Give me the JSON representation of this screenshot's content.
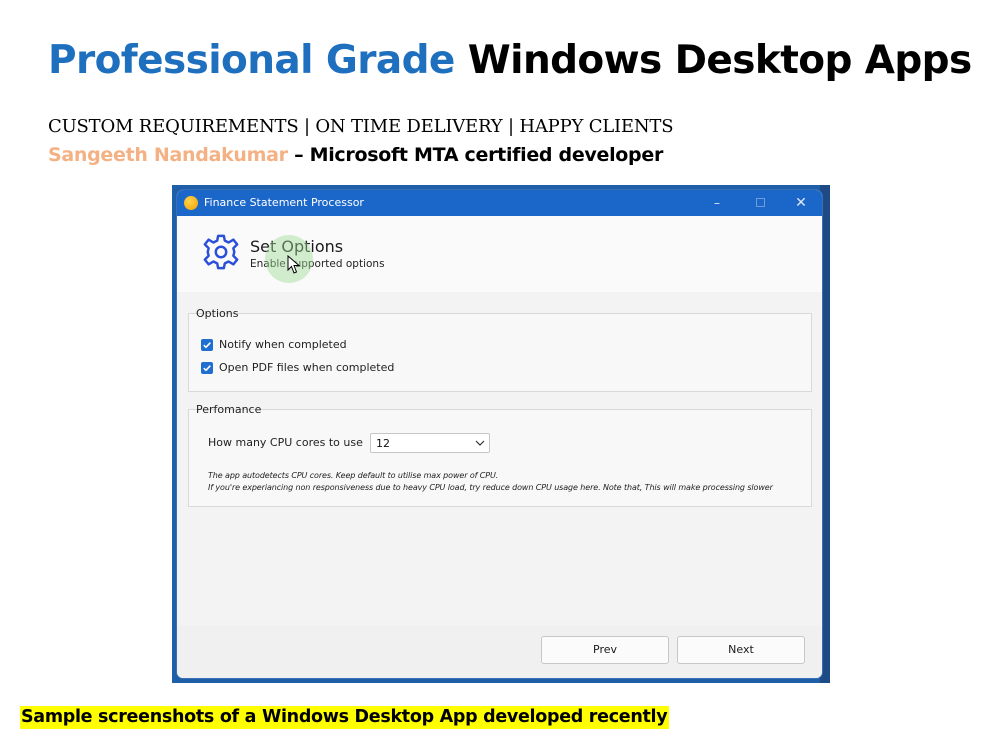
{
  "slide": {
    "title_accent": "Professional Grade",
    "title_rest": "Windows Desktop Apps",
    "subtitle": "CUSTOM REQUIREMENTS | ON TIME DELIVERY | HAPPY CLIENTS",
    "author_name": "Sangeeth Nandakumar",
    "author_desc": " – Microsoft MTA certified developer",
    "caption": "Sample screenshots of a Windows Desktop App developed recently",
    "colors": {
      "title_accent": "#1f6fbf",
      "author_name": "#f4b183",
      "caption_highlight": "#ffff00"
    }
  },
  "window": {
    "title": "Finance Statement Processor",
    "app_icon": "app-orb-icon",
    "controls": {
      "minimize": "–",
      "close": "✕"
    },
    "colors": {
      "titlebar": "#1b66c9",
      "accent": "#1f6fd0"
    }
  },
  "header": {
    "icon": "gear-icon",
    "title": "Set Options",
    "subtitle": "Enable supported options"
  },
  "options": {
    "label": "Options",
    "items": [
      {
        "label": "Notify when completed",
        "checked": true
      },
      {
        "label": "Open PDF files when completed",
        "checked": true
      }
    ]
  },
  "performance": {
    "label": "Perfomance",
    "cpu_label": "How many CPU cores to use",
    "cpu_value": "12",
    "note_line1": "The app autodetects CPU cores. Keep default to utilise max power of CPU.",
    "note_line2": "If you're experiancing non responsiveness due to heavy CPU load, try reduce down CPU usage here. Note that, This will make processing slower"
  },
  "footer": {
    "prev_label": "Prev",
    "next_label": "Next"
  }
}
